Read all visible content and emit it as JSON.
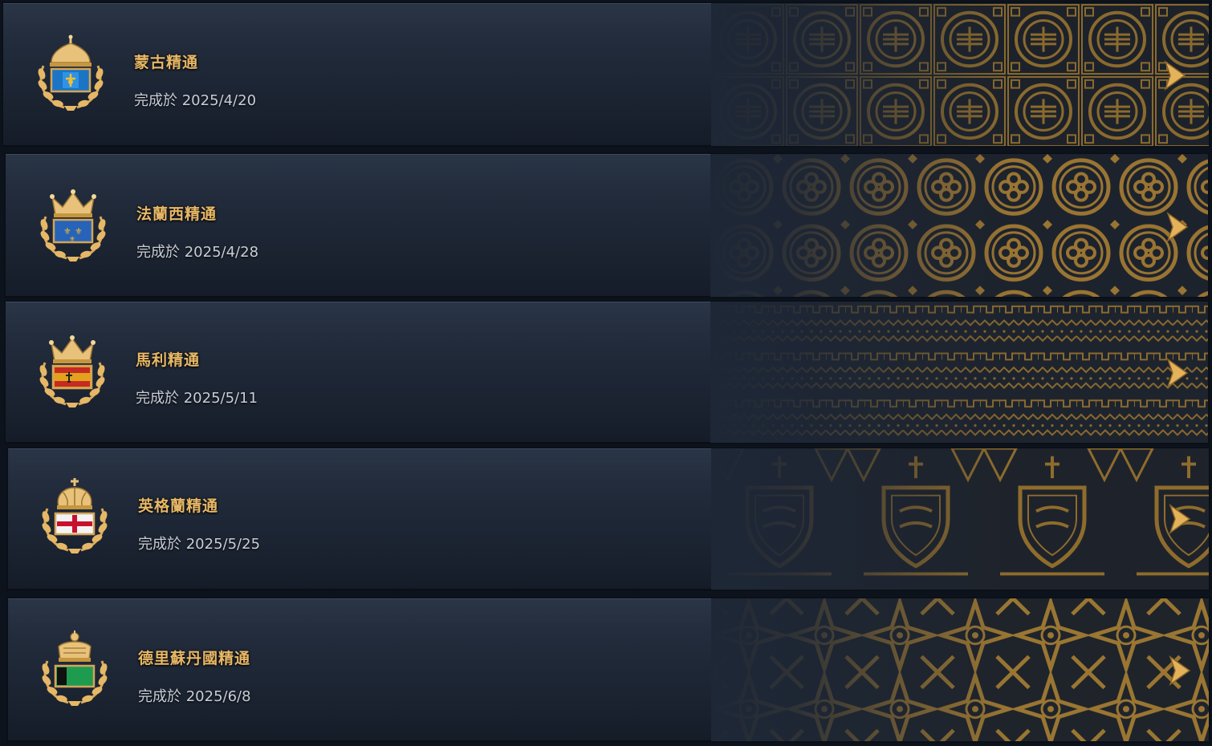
{
  "colors": {
    "title_gold": "#e8b867",
    "date_text": "#c9ced6",
    "row_bg": "#1e2736",
    "pattern_gold": "#8a6a2e",
    "arrow_gold": "#e3b25b"
  },
  "entries": [
    {
      "title": "蒙古精通",
      "completed_label": "完成於 2025/4/20",
      "crown_icon": "mongol-crown-icon",
      "flag_icon": "mongolia-flag-icon",
      "pattern": "chinese-medallion-pattern"
    },
    {
      "title": "法蘭西精通",
      "completed_label": "完成於 2025/4/28",
      "crown_icon": "royal-crown-icon",
      "flag_icon": "france-fleur-de-lis-flag-icon",
      "pattern": "quatrefoil-medallion-pattern"
    },
    {
      "title": "馬利精通",
      "completed_label": "完成於 2025/5/11",
      "crown_icon": "royal-crown-icon",
      "flag_icon": "mali-flag-icon",
      "pattern": "zigzag-meander-pattern"
    },
    {
      "title": "英格蘭精通",
      "completed_label": "完成於 2025/5/25",
      "crown_icon": "imperial-crown-icon",
      "flag_icon": "england-st-george-flag-icon",
      "pattern": "heraldic-lion-shield-pattern"
    },
    {
      "title": "德里蘇丹國精通",
      "completed_label": "完成於 2025/6/8",
      "crown_icon": "sultan-crown-icon",
      "flag_icon": "delhi-sultanate-flag-icon",
      "pattern": "islamic-star-pattern"
    }
  ]
}
